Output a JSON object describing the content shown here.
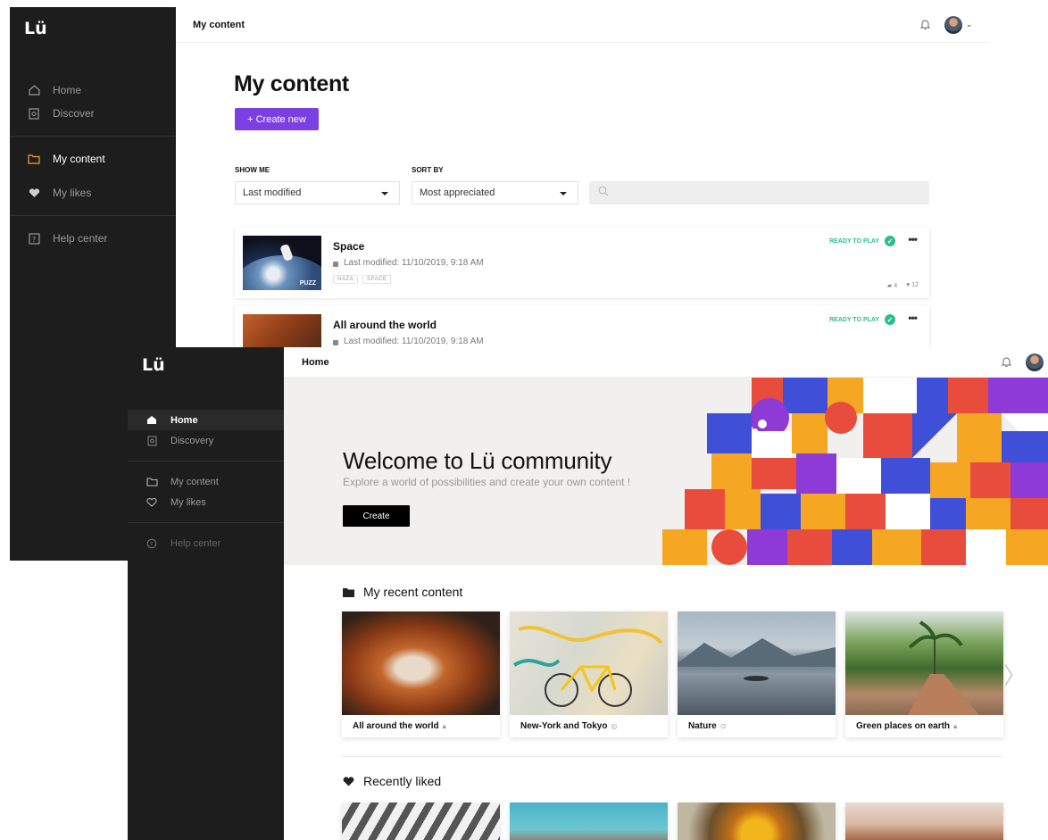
{
  "back": {
    "logo": "Lü",
    "topbar_title": "My content",
    "nav": [
      {
        "label": "Home",
        "icon": "home-icon"
      },
      {
        "label": "Discover",
        "icon": "discover-icon"
      },
      {
        "label": "My content",
        "icon": "folder-icon"
      },
      {
        "label": "My likes",
        "icon": "heart-icon"
      },
      {
        "label": "Help center",
        "icon": "help-icon"
      }
    ],
    "page_title": "My content",
    "create_new": "+ Create new",
    "show_me_label": "SHOW ME",
    "show_me_value": "Last modified",
    "sort_by_label": "SORT BY",
    "sort_by_value": "Most appreciated",
    "items": [
      {
        "title": "Space",
        "meta": "Last modified: 11/10/2019, 9:18 AM",
        "status": "READY TO PLAY",
        "tags": [
          "NAZA",
          "SPACE"
        ],
        "thumb_tag": "PUZZ",
        "count_a": "4",
        "count_b": "12"
      },
      {
        "title": "All around the world",
        "meta": "Last modified: 11/10/2019, 9:18 AM",
        "status": "READY TO PLAY"
      }
    ],
    "more": "•••"
  },
  "front": {
    "logo": "Lü",
    "topbar_title": "Home",
    "nav": [
      {
        "label": "Home",
        "icon": "home-icon"
      },
      {
        "label": "Discovery",
        "icon": "discover-icon"
      },
      {
        "label": "My content",
        "icon": "folder-icon"
      },
      {
        "label": "My likes",
        "icon": "heart-icon"
      },
      {
        "label": "Help center",
        "icon": "help-icon"
      }
    ],
    "hero": {
      "title": "Welcome to Lü community",
      "subtitle": "Explore a world of possibilities and create your own content !",
      "button": "Create"
    },
    "recent_title": "My recent content",
    "recent": [
      {
        "label": "All around the world",
        "icon": "lock-icon"
      },
      {
        "label": "New-York and Tokyo",
        "icon": "globe-icon"
      },
      {
        "label": "Nature",
        "icon": "share-icon"
      },
      {
        "label": "Green places on earth",
        "icon": "lock-icon"
      }
    ],
    "liked_title": "Recently liked"
  },
  "colors": {
    "accent": "#7b3fe4",
    "sidebar": "#1d1d1d",
    "ready": "#2bbd8e",
    "brand_dot": "#f5a623"
  }
}
